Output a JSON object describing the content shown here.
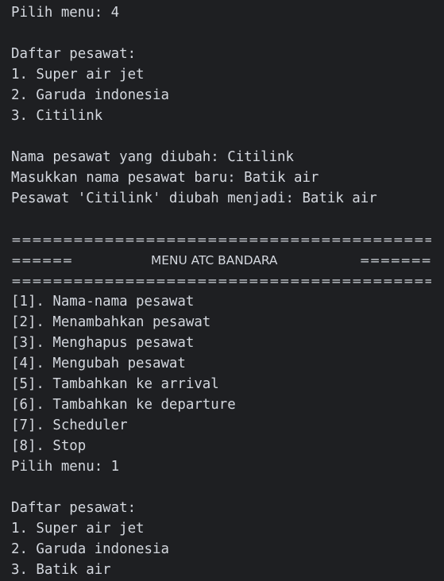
{
  "console": {
    "lines": [
      "Pilih menu: 4",
      "",
      "Daftar pesawat:",
      "1. Super air jet",
      "2. Garuda indonesia",
      "3. Citilink",
      "",
      "Nama pesawat yang diubah: Citilink",
      "Masukkan nama pesawat baru: Batik air",
      "Pesawat 'Citilink' diubah menjadi: Batik air",
      "",
      "================================================",
      "",
      "================================================",
      "[1]. Nama-nama pesawat",
      "[2]. Menambahkan pesawat",
      "[3]. Menghapus pesawat",
      "[4]. Mengubah pesawat",
      "[5]. Tambahkan ke arrival",
      "[6]. Tambahkan ke departure",
      "[7]. Scheduler",
      "[8]. Stop",
      "Pilih menu: 1",
      "",
      "Daftar pesawat:",
      "1. Super air jet",
      "2. Garuda indonesia",
      "3. Batik air"
    ],
    "title_row": {
      "left": "======",
      "center": "MENU ATC BANDARA",
      "right": "======="
    }
  },
  "colors": {
    "background": "#1e1f22",
    "text": "#d4d8df"
  }
}
